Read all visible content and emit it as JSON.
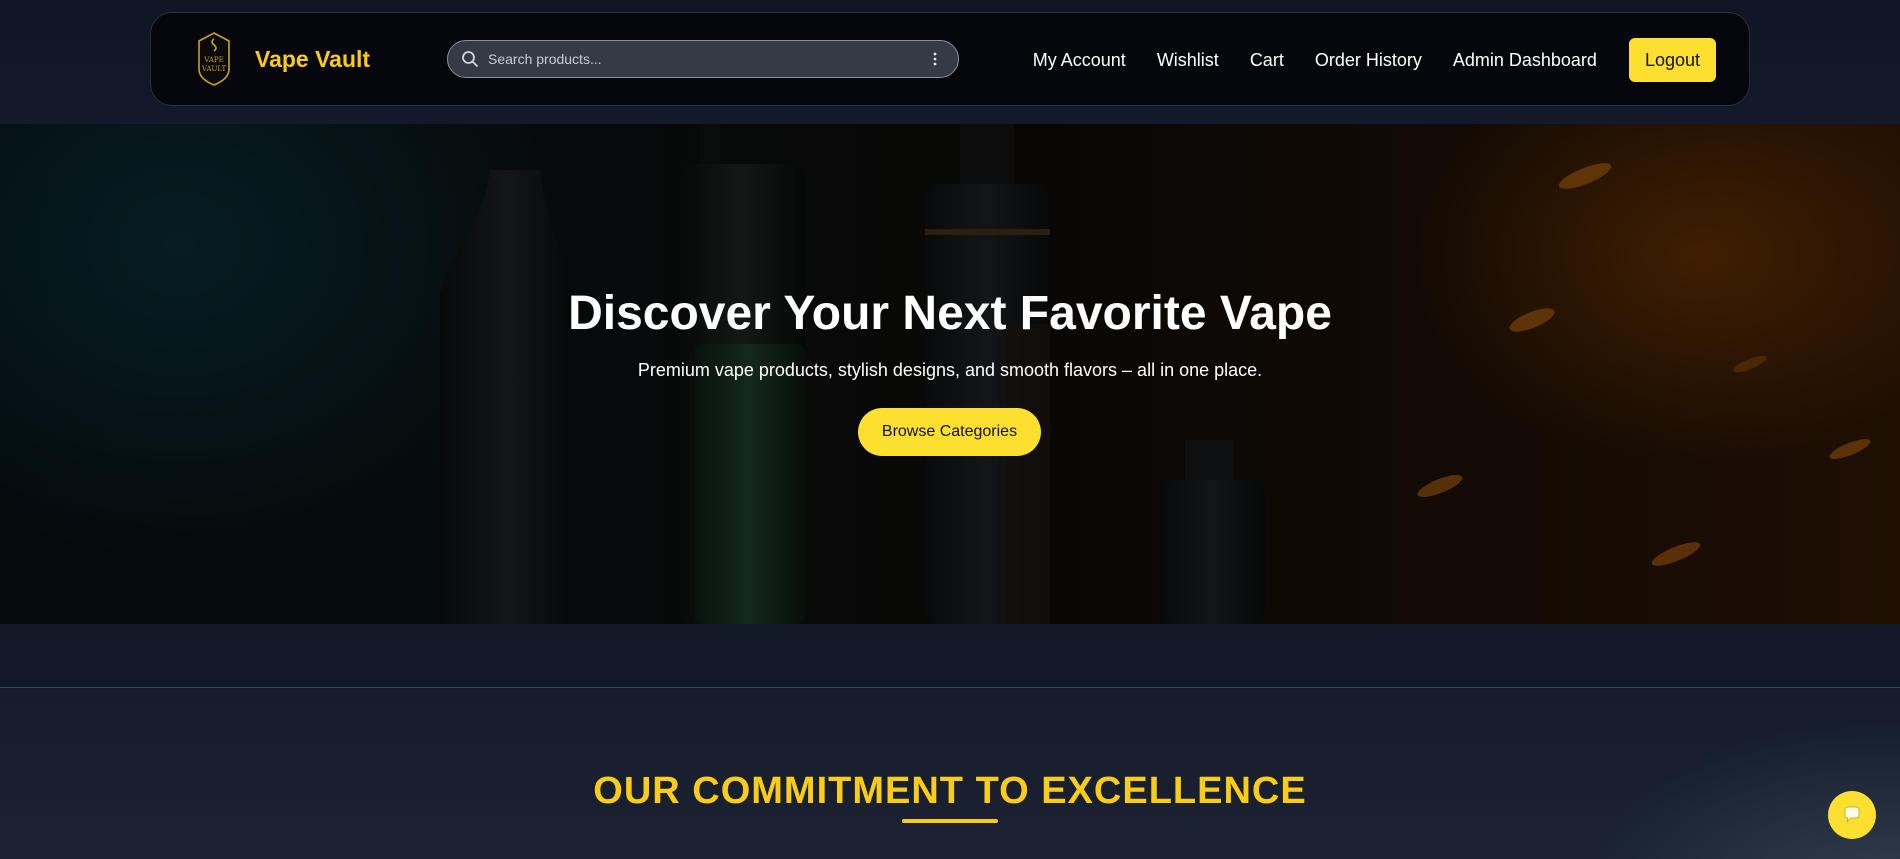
{
  "header": {
    "brand_name": "Vape Vault",
    "logo_text": [
      "VAPE",
      "VAULT"
    ],
    "search_placeholder": "Search products...",
    "nav_links": [
      "My Account",
      "Wishlist",
      "Cart",
      "Order History",
      "Admin Dashboard"
    ],
    "logout_label": "Logout"
  },
  "hero": {
    "title": "Discover Your Next Favorite Vape",
    "subtitle": "Premium vape products, stylish designs, and smooth flavors – all in one place.",
    "cta_label": "Browse Categories"
  },
  "commitment": {
    "title": "OUR COMMITMENT TO EXCELLENCE"
  },
  "icons": {
    "logo": "shield-logo-icon",
    "search": "search-icon",
    "more": "kebab-menu-icon",
    "chat": "chat-bubble-icon"
  },
  "colors": {
    "accent": "#facc15",
    "button": "#fde02f",
    "background": "#111827",
    "navbar": "#05070c"
  }
}
